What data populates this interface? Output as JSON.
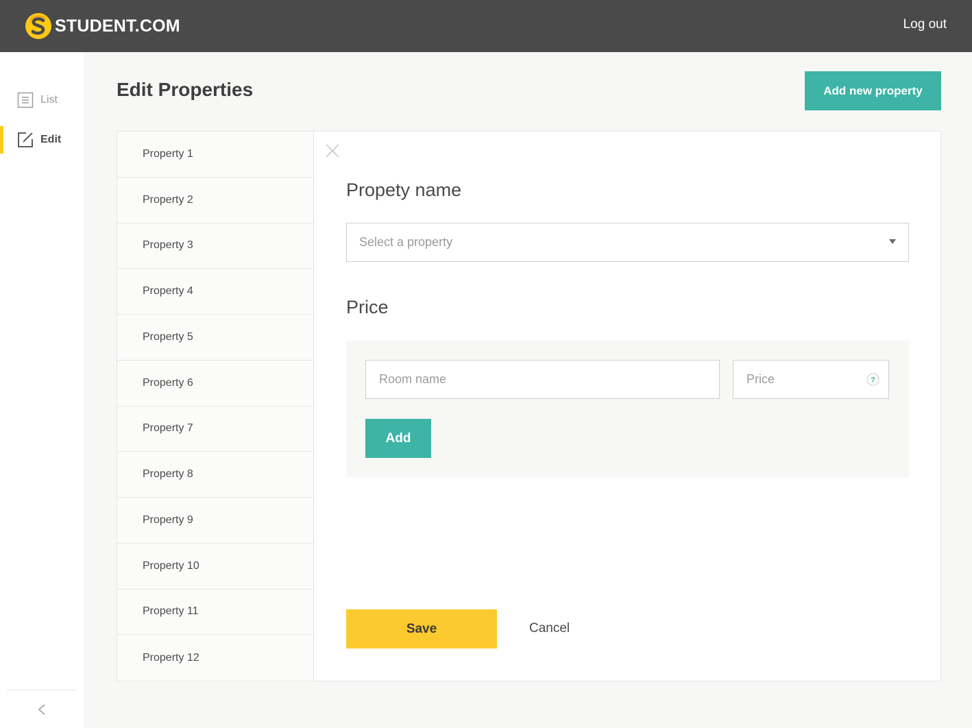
{
  "header": {
    "brand": "STUDENT.COM",
    "logout_label": "Log out",
    "colors": {
      "bar": "#4a4a4a",
      "logo_accent": "#fcc916"
    }
  },
  "sidebar": {
    "items": [
      {
        "label": "List",
        "icon": "list-icon",
        "active": false
      },
      {
        "label": "Edit",
        "icon": "edit-icon",
        "active": true
      }
    ],
    "collapse_icon": "chevron-left-icon"
  },
  "main": {
    "title": "Edit Properties",
    "add_property_label": "Add new property"
  },
  "properties": [
    "Property 1",
    "Property 2",
    "Property 3",
    "Property 4",
    "Property 5",
    "Property 6",
    "Property 7",
    "Property 8",
    "Property 9",
    "Property 10",
    "Property 11",
    "Property 12"
  ],
  "form": {
    "close_icon": "close-icon",
    "name_label": "Propety name",
    "select_placeholder": "Select a property",
    "price_label": "Price",
    "room_placeholder": "Room name",
    "price_placeholder": "Price",
    "help_icon": "question-icon",
    "add_label": "Add",
    "save_label": "Save",
    "cancel_label": "Cancel"
  },
  "colors": {
    "teal": "#3db4a6",
    "yellow": "#fcc92e"
  }
}
